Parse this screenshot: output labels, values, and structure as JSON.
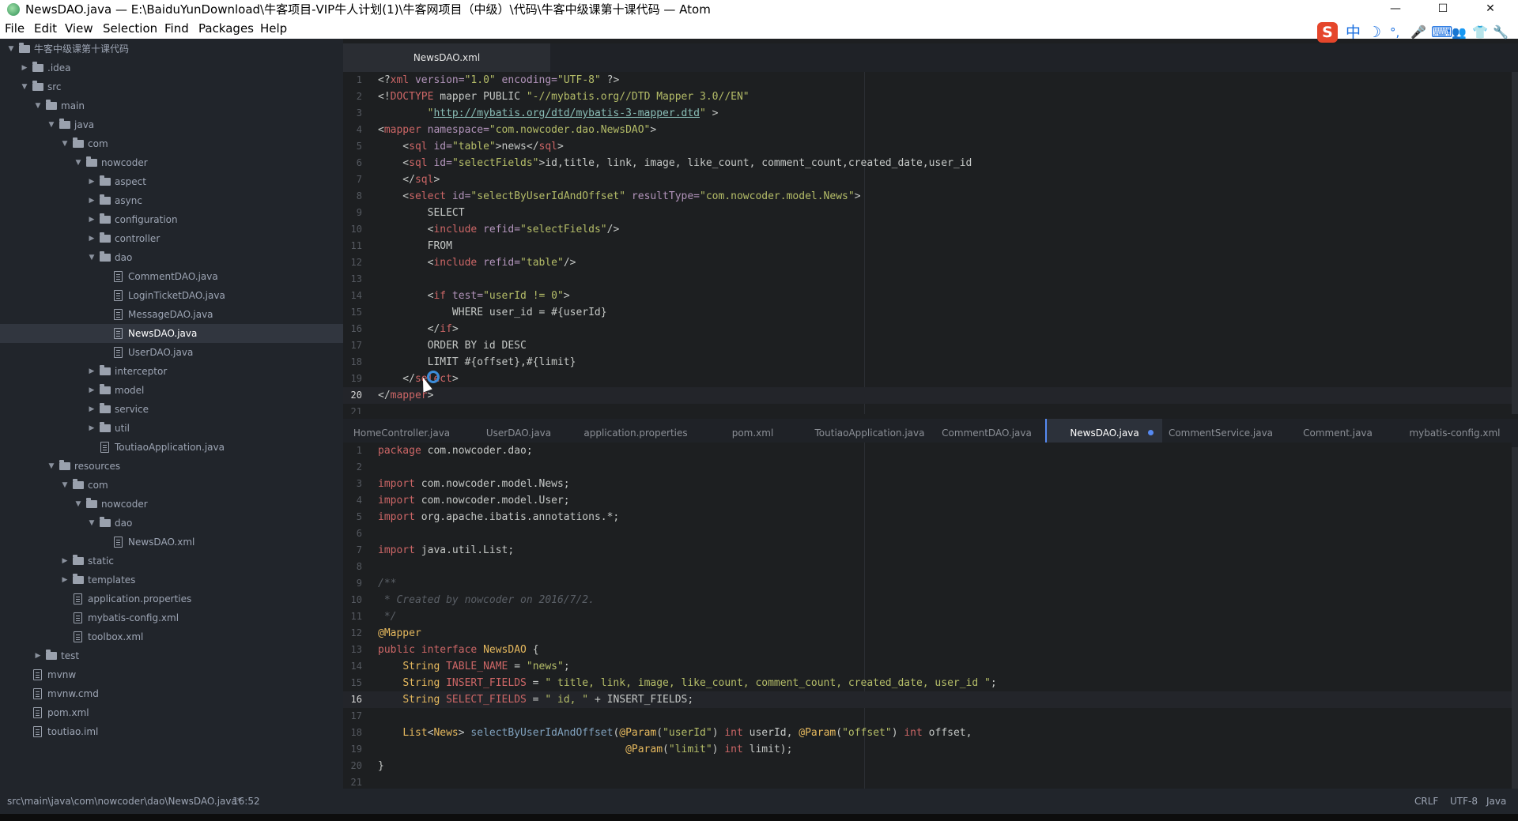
{
  "window": {
    "title": "NewsDAO.java — E:\\BaiduYunDownload\\牛客项目-VIP牛人计划(1)\\牛客网项目（中级）\\代码\\牛客中级课第十课代码 — Atom",
    "minimize_glyph": "—",
    "maximize_glyph": "☐",
    "close_glyph": "✕"
  },
  "menu": [
    "File",
    "Edit",
    "View",
    "Selection",
    "Find",
    "Packages",
    "Help"
  ],
  "ime_icons": [
    "S",
    "中",
    "☽",
    "°,",
    "🎤",
    "⌨",
    "👥",
    "👕",
    "🔧"
  ],
  "tree": [
    {
      "label": "牛客中级课第十课代码",
      "depth": 0,
      "type": "folder",
      "expanded": true
    },
    {
      "label": ".idea",
      "depth": 1,
      "type": "folder",
      "expanded": false
    },
    {
      "label": "src",
      "depth": 1,
      "type": "folder",
      "expanded": true
    },
    {
      "label": "main",
      "depth": 2,
      "type": "folder",
      "expanded": true
    },
    {
      "label": "java",
      "depth": 3,
      "type": "folder",
      "expanded": true
    },
    {
      "label": "com",
      "depth": 4,
      "type": "folder",
      "expanded": true
    },
    {
      "label": "nowcoder",
      "depth": 5,
      "type": "folder",
      "expanded": true
    },
    {
      "label": "aspect",
      "depth": 6,
      "type": "folder",
      "expanded": false
    },
    {
      "label": "async",
      "depth": 6,
      "type": "folder",
      "expanded": false
    },
    {
      "label": "configuration",
      "depth": 6,
      "type": "folder",
      "expanded": false
    },
    {
      "label": "controller",
      "depth": 6,
      "type": "folder",
      "expanded": false
    },
    {
      "label": "dao",
      "depth": 6,
      "type": "folder",
      "expanded": true
    },
    {
      "label": "CommentDAO.java",
      "depth": 7,
      "type": "file"
    },
    {
      "label": "LoginTicketDAO.java",
      "depth": 7,
      "type": "file"
    },
    {
      "label": "MessageDAO.java",
      "depth": 7,
      "type": "file"
    },
    {
      "label": "NewsDAO.java",
      "depth": 7,
      "type": "file",
      "selected": true
    },
    {
      "label": "UserDAO.java",
      "depth": 7,
      "type": "file"
    },
    {
      "label": "interceptor",
      "depth": 6,
      "type": "folder",
      "expanded": false
    },
    {
      "label": "model",
      "depth": 6,
      "type": "folder",
      "expanded": false
    },
    {
      "label": "service",
      "depth": 6,
      "type": "folder",
      "expanded": false
    },
    {
      "label": "util",
      "depth": 6,
      "type": "folder",
      "expanded": false
    },
    {
      "label": "ToutiaoApplication.java",
      "depth": 6,
      "type": "file"
    },
    {
      "label": "resources",
      "depth": 3,
      "type": "folder",
      "expanded": true
    },
    {
      "label": "com",
      "depth": 4,
      "type": "folder",
      "expanded": true
    },
    {
      "label": "nowcoder",
      "depth": 5,
      "type": "folder",
      "expanded": true
    },
    {
      "label": "dao",
      "depth": 6,
      "type": "folder",
      "expanded": true
    },
    {
      "label": "NewsDAO.xml",
      "depth": 7,
      "type": "file"
    },
    {
      "label": "static",
      "depth": 4,
      "type": "folder",
      "expanded": false
    },
    {
      "label": "templates",
      "depth": 4,
      "type": "folder",
      "expanded": false
    },
    {
      "label": "application.properties",
      "depth": 4,
      "type": "file"
    },
    {
      "label": "mybatis-config.xml",
      "depth": 4,
      "type": "file"
    },
    {
      "label": "toolbox.xml",
      "depth": 4,
      "type": "file"
    },
    {
      "label": "test",
      "depth": 2,
      "type": "folder",
      "expanded": false
    },
    {
      "label": "mvnw",
      "depth": 1,
      "type": "file"
    },
    {
      "label": "mvnw.cmd",
      "depth": 1,
      "type": "file"
    },
    {
      "label": "pom.xml",
      "depth": 1,
      "type": "file"
    },
    {
      "label": "toutiao.iml",
      "depth": 1,
      "type": "file"
    }
  ],
  "top_pane": {
    "tabs": [
      {
        "label": "NewsDAO.xml",
        "active": true
      }
    ],
    "current_line": 20,
    "lines": [
      {
        "n": "1",
        "t": [
          [
            "p",
            "<?"
          ],
          [
            "k",
            "xml"
          ],
          [
            "a",
            " version="
          ],
          [
            "s",
            "\"1.0\""
          ],
          [
            "a",
            " encoding="
          ],
          [
            "s",
            "\"UTF-8\""
          ],
          [
            "p",
            " ?>"
          ]
        ]
      },
      {
        "n": "2",
        "t": [
          [
            "p",
            "<!"
          ],
          [
            "k",
            "DOCTYPE"
          ],
          [
            "p",
            " mapper PUBLIC "
          ],
          [
            "s",
            "\"-//mybatis.org//DTD Mapper 3.0//EN\""
          ]
        ]
      },
      {
        "n": "3",
        "t": [
          [
            "p",
            "        "
          ],
          [
            "s",
            "\""
          ],
          [
            "u",
            "http://mybatis.org/dtd/mybatis-3-mapper.dtd"
          ],
          [
            "s",
            "\""
          ],
          [
            "p",
            " >"
          ]
        ]
      },
      {
        "n": "4",
        "t": [
          [
            "p",
            "<"
          ],
          [
            "k",
            "mapper"
          ],
          [
            "a",
            " namespace="
          ],
          [
            "s",
            "\"com.nowcoder.dao.NewsDAO\""
          ],
          [
            "p",
            ">"
          ]
        ]
      },
      {
        "n": "5",
        "t": [
          [
            "p",
            "    <"
          ],
          [
            "k",
            "sql"
          ],
          [
            "a",
            " id="
          ],
          [
            "s",
            "\"table\""
          ],
          [
            "p",
            ">news</"
          ],
          [
            "k",
            "sql"
          ],
          [
            "p",
            ">"
          ]
        ]
      },
      {
        "n": "6",
        "t": [
          [
            "p",
            "    <"
          ],
          [
            "k",
            "sql"
          ],
          [
            "a",
            " id="
          ],
          [
            "s",
            "\"selectFields\""
          ],
          [
            "p",
            ">id,title, link, image, like_count, comment_count,created_date,user_id"
          ]
        ]
      },
      {
        "n": "7",
        "t": [
          [
            "p",
            "    </"
          ],
          [
            "k",
            "sql"
          ],
          [
            "p",
            ">"
          ]
        ]
      },
      {
        "n": "8",
        "t": [
          [
            "p",
            "    <"
          ],
          [
            "k",
            "select"
          ],
          [
            "a",
            " id="
          ],
          [
            "s",
            "\"selectByUserIdAndOffset\""
          ],
          [
            "a",
            " resultType="
          ],
          [
            "s",
            "\"com.nowcoder.model.News\""
          ],
          [
            "p",
            ">"
          ]
        ]
      },
      {
        "n": "9",
        "t": [
          [
            "p",
            "        SELECT"
          ]
        ]
      },
      {
        "n": "10",
        "t": [
          [
            "p",
            "        <"
          ],
          [
            "k",
            "include"
          ],
          [
            "a",
            " refid="
          ],
          [
            "s",
            "\"selectFields\""
          ],
          [
            "p",
            "/>"
          ]
        ]
      },
      {
        "n": "11",
        "t": [
          [
            "p",
            "        FROM"
          ]
        ]
      },
      {
        "n": "12",
        "t": [
          [
            "p",
            "        <"
          ],
          [
            "k",
            "include"
          ],
          [
            "a",
            " refid="
          ],
          [
            "s",
            "\"table\""
          ],
          [
            "p",
            "/>"
          ]
        ]
      },
      {
        "n": "13",
        "t": [
          [
            "p",
            ""
          ]
        ]
      },
      {
        "n": "14",
        "t": [
          [
            "p",
            "        <"
          ],
          [
            "k",
            "if"
          ],
          [
            "a",
            " test="
          ],
          [
            "s",
            "\"userId != 0\""
          ],
          [
            "p",
            ">"
          ]
        ]
      },
      {
        "n": "15",
        "t": [
          [
            "p",
            "            WHERE user_id = #{userId}"
          ]
        ]
      },
      {
        "n": "16",
        "t": [
          [
            "p",
            "        </"
          ],
          [
            "k",
            "if"
          ],
          [
            "p",
            ">"
          ]
        ]
      },
      {
        "n": "17",
        "t": [
          [
            "p",
            "        ORDER BY id DESC"
          ]
        ]
      },
      {
        "n": "18",
        "t": [
          [
            "p",
            "        LIMIT #{offset},#{limit}"
          ]
        ]
      },
      {
        "n": "19",
        "t": [
          [
            "p",
            "    </"
          ],
          [
            "k",
            "select"
          ],
          [
            "p",
            ">"
          ]
        ]
      },
      {
        "n": "20",
        "t": [
          [
            "p",
            "</"
          ],
          [
            "k",
            "mapper"
          ],
          [
            "p",
            ">"
          ]
        ]
      },
      {
        "n": "21",
        "t": [
          [
            "p",
            ""
          ]
        ]
      }
    ]
  },
  "bottom_pane": {
    "tabs": [
      {
        "label": "HomeController.java"
      },
      {
        "label": "UserDAO.java"
      },
      {
        "label": "application.properties"
      },
      {
        "label": "pom.xml"
      },
      {
        "label": "ToutiaoApplication.java"
      },
      {
        "label": "CommentDAO.java"
      },
      {
        "label": "NewsDAO.java",
        "active": true,
        "modified": true
      },
      {
        "label": "CommentService.java"
      },
      {
        "label": "Comment.java"
      },
      {
        "label": "mybatis-config.xml"
      }
    ],
    "current_line": 16,
    "lines": [
      {
        "n": "1",
        "t": [
          [
            "k",
            "package"
          ],
          [
            "p",
            " com.nowcoder.dao;"
          ]
        ]
      },
      {
        "n": "2",
        "t": [
          [
            "p",
            ""
          ]
        ]
      },
      {
        "n": "3",
        "t": [
          [
            "k",
            "import"
          ],
          [
            "p",
            " com.nowcoder.model.News;"
          ]
        ]
      },
      {
        "n": "4",
        "t": [
          [
            "k",
            "import"
          ],
          [
            "p",
            " com.nowcoder.model.User;"
          ]
        ]
      },
      {
        "n": "5",
        "t": [
          [
            "k",
            "import"
          ],
          [
            "p",
            " org.apache.ibatis.annotations.*;"
          ]
        ]
      },
      {
        "n": "6",
        "t": [
          [
            "p",
            ""
          ]
        ]
      },
      {
        "n": "7",
        "t": [
          [
            "k",
            "import"
          ],
          [
            "p",
            " java.util.List;"
          ]
        ]
      },
      {
        "n": "8",
        "t": [
          [
            "p",
            ""
          ]
        ]
      },
      {
        "n": "9",
        "t": [
          [
            "c",
            "/**"
          ]
        ]
      },
      {
        "n": "10",
        "t": [
          [
            "c",
            " * Created by nowcoder on 2016/7/2."
          ]
        ]
      },
      {
        "n": "11",
        "t": [
          [
            "c",
            " */"
          ]
        ]
      },
      {
        "n": "12",
        "t": [
          [
            "t",
            "@Mapper"
          ]
        ]
      },
      {
        "n": "13",
        "t": [
          [
            "k",
            "public"
          ],
          [
            "p",
            " "
          ],
          [
            "k",
            "interface"
          ],
          [
            "p",
            " "
          ],
          [
            "t",
            "NewsDAO"
          ],
          [
            "p",
            " {"
          ]
        ]
      },
      {
        "n": "14",
        "t": [
          [
            "p",
            "    "
          ],
          [
            "t",
            "String"
          ],
          [
            "p",
            " "
          ],
          [
            "k",
            "TABLE_NAME"
          ],
          [
            "p",
            " = "
          ],
          [
            "s",
            "\"news\""
          ],
          [
            "p",
            ";"
          ]
        ]
      },
      {
        "n": "15",
        "t": [
          [
            "p",
            "    "
          ],
          [
            "t",
            "String"
          ],
          [
            "p",
            " "
          ],
          [
            "k",
            "INSERT_FIELDS"
          ],
          [
            "p",
            " = "
          ],
          [
            "s",
            "\" title, link, image, like_count, comment_count, created_date, user_id \""
          ],
          [
            "p",
            ";"
          ]
        ]
      },
      {
        "n": "16",
        "t": [
          [
            "p",
            "    "
          ],
          [
            "t",
            "String"
          ],
          [
            "p",
            " "
          ],
          [
            "k",
            "SELECT_FIELDS"
          ],
          [
            "p",
            " = "
          ],
          [
            "s",
            "\" id, \""
          ],
          [
            "p",
            " + INSERT_FIELDS;"
          ]
        ]
      },
      {
        "n": "17",
        "t": [
          [
            "p",
            ""
          ]
        ]
      },
      {
        "n": "18",
        "t": [
          [
            "p",
            "    "
          ],
          [
            "t",
            "List"
          ],
          [
            "p",
            "<"
          ],
          [
            "t",
            "News"
          ],
          [
            "p",
            "> "
          ],
          [
            "f",
            "selectByUserIdAndOffset"
          ],
          [
            "p",
            "("
          ],
          [
            "t",
            "@Param"
          ],
          [
            "p",
            "("
          ],
          [
            "s",
            "\"userId\""
          ],
          [
            "p",
            ") "
          ],
          [
            "k",
            "int"
          ],
          [
            "p",
            " userId, "
          ],
          [
            "t",
            "@Param"
          ],
          [
            "p",
            "("
          ],
          [
            "s",
            "\"offset\""
          ],
          [
            "p",
            ") "
          ],
          [
            "k",
            "int"
          ],
          [
            "p",
            " offset,"
          ]
        ]
      },
      {
        "n": "19",
        "t": [
          [
            "p",
            "                                        "
          ],
          [
            "t",
            "@Param"
          ],
          [
            "p",
            "("
          ],
          [
            "s",
            "\"limit\""
          ],
          [
            "p",
            ") "
          ],
          [
            "k",
            "int"
          ],
          [
            "p",
            " limit);"
          ]
        ]
      },
      {
        "n": "20",
        "t": [
          [
            "p",
            "}"
          ]
        ]
      },
      {
        "n": "21",
        "t": [
          [
            "p",
            ""
          ]
        ]
      }
    ]
  },
  "status": {
    "path": "src\\main\\java\\com\\nowcoder\\dao\\NewsDAO.java*",
    "cursor": "16:52",
    "line_ending": "CRLF",
    "encoding": "UTF-8",
    "grammar": "Java"
  }
}
